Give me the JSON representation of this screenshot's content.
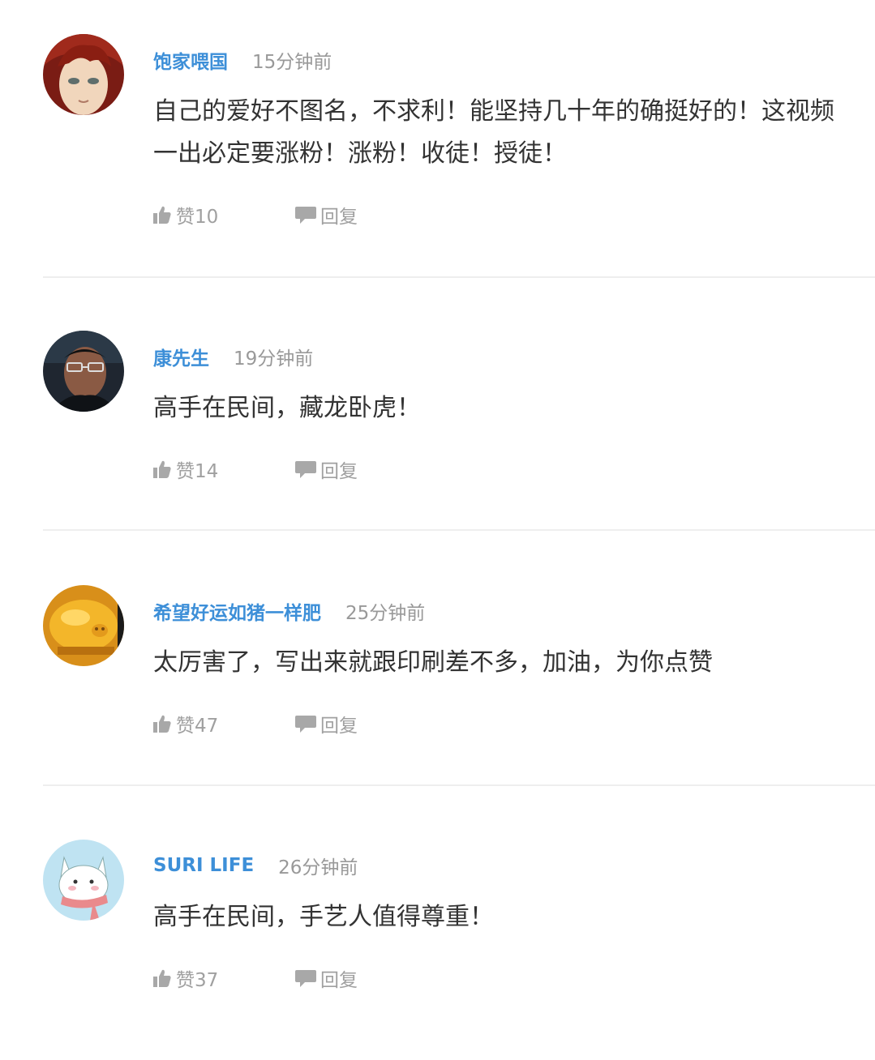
{
  "comments": [
    {
      "username": "饱家喂国",
      "time": "15分钟前",
      "text": "自己的爱好不图名，不求利！能坚持几十年的确挺好的！这视频一出必定要涨粉！涨粉！收徒！授徒！",
      "like_label": "赞10",
      "reply_label": "回复",
      "avatar": "anime-face-avatar"
    },
    {
      "username": "康先生",
      "time": "19分钟前",
      "text": "高手在民间，藏龙卧虎！",
      "like_label": "赞14",
      "reply_label": "回复",
      "avatar": "man-with-glasses-avatar"
    },
    {
      "username": "希望好运如猪一样肥",
      "time": "25分钟前",
      "text": "太厉害了，写出来就跟印刷差不多，加油，为你点赞",
      "like_label": "赞47",
      "reply_label": "回复",
      "avatar": "golden-pig-avatar"
    },
    {
      "username": "SURI LIFE",
      "time": "26分钟前",
      "text": "高手在民间，手艺人值得尊重！",
      "like_label": "赞37",
      "reply_label": "回复",
      "avatar": "white-cat-avatar"
    }
  ],
  "colors": {
    "username": "#3d8fd8",
    "time": "#999999",
    "text": "#333333",
    "action": "#a0a0a0",
    "divider": "#eeeeee"
  },
  "icons": {
    "like": "thumbs-up-icon",
    "reply": "speech-bubble-icon"
  }
}
